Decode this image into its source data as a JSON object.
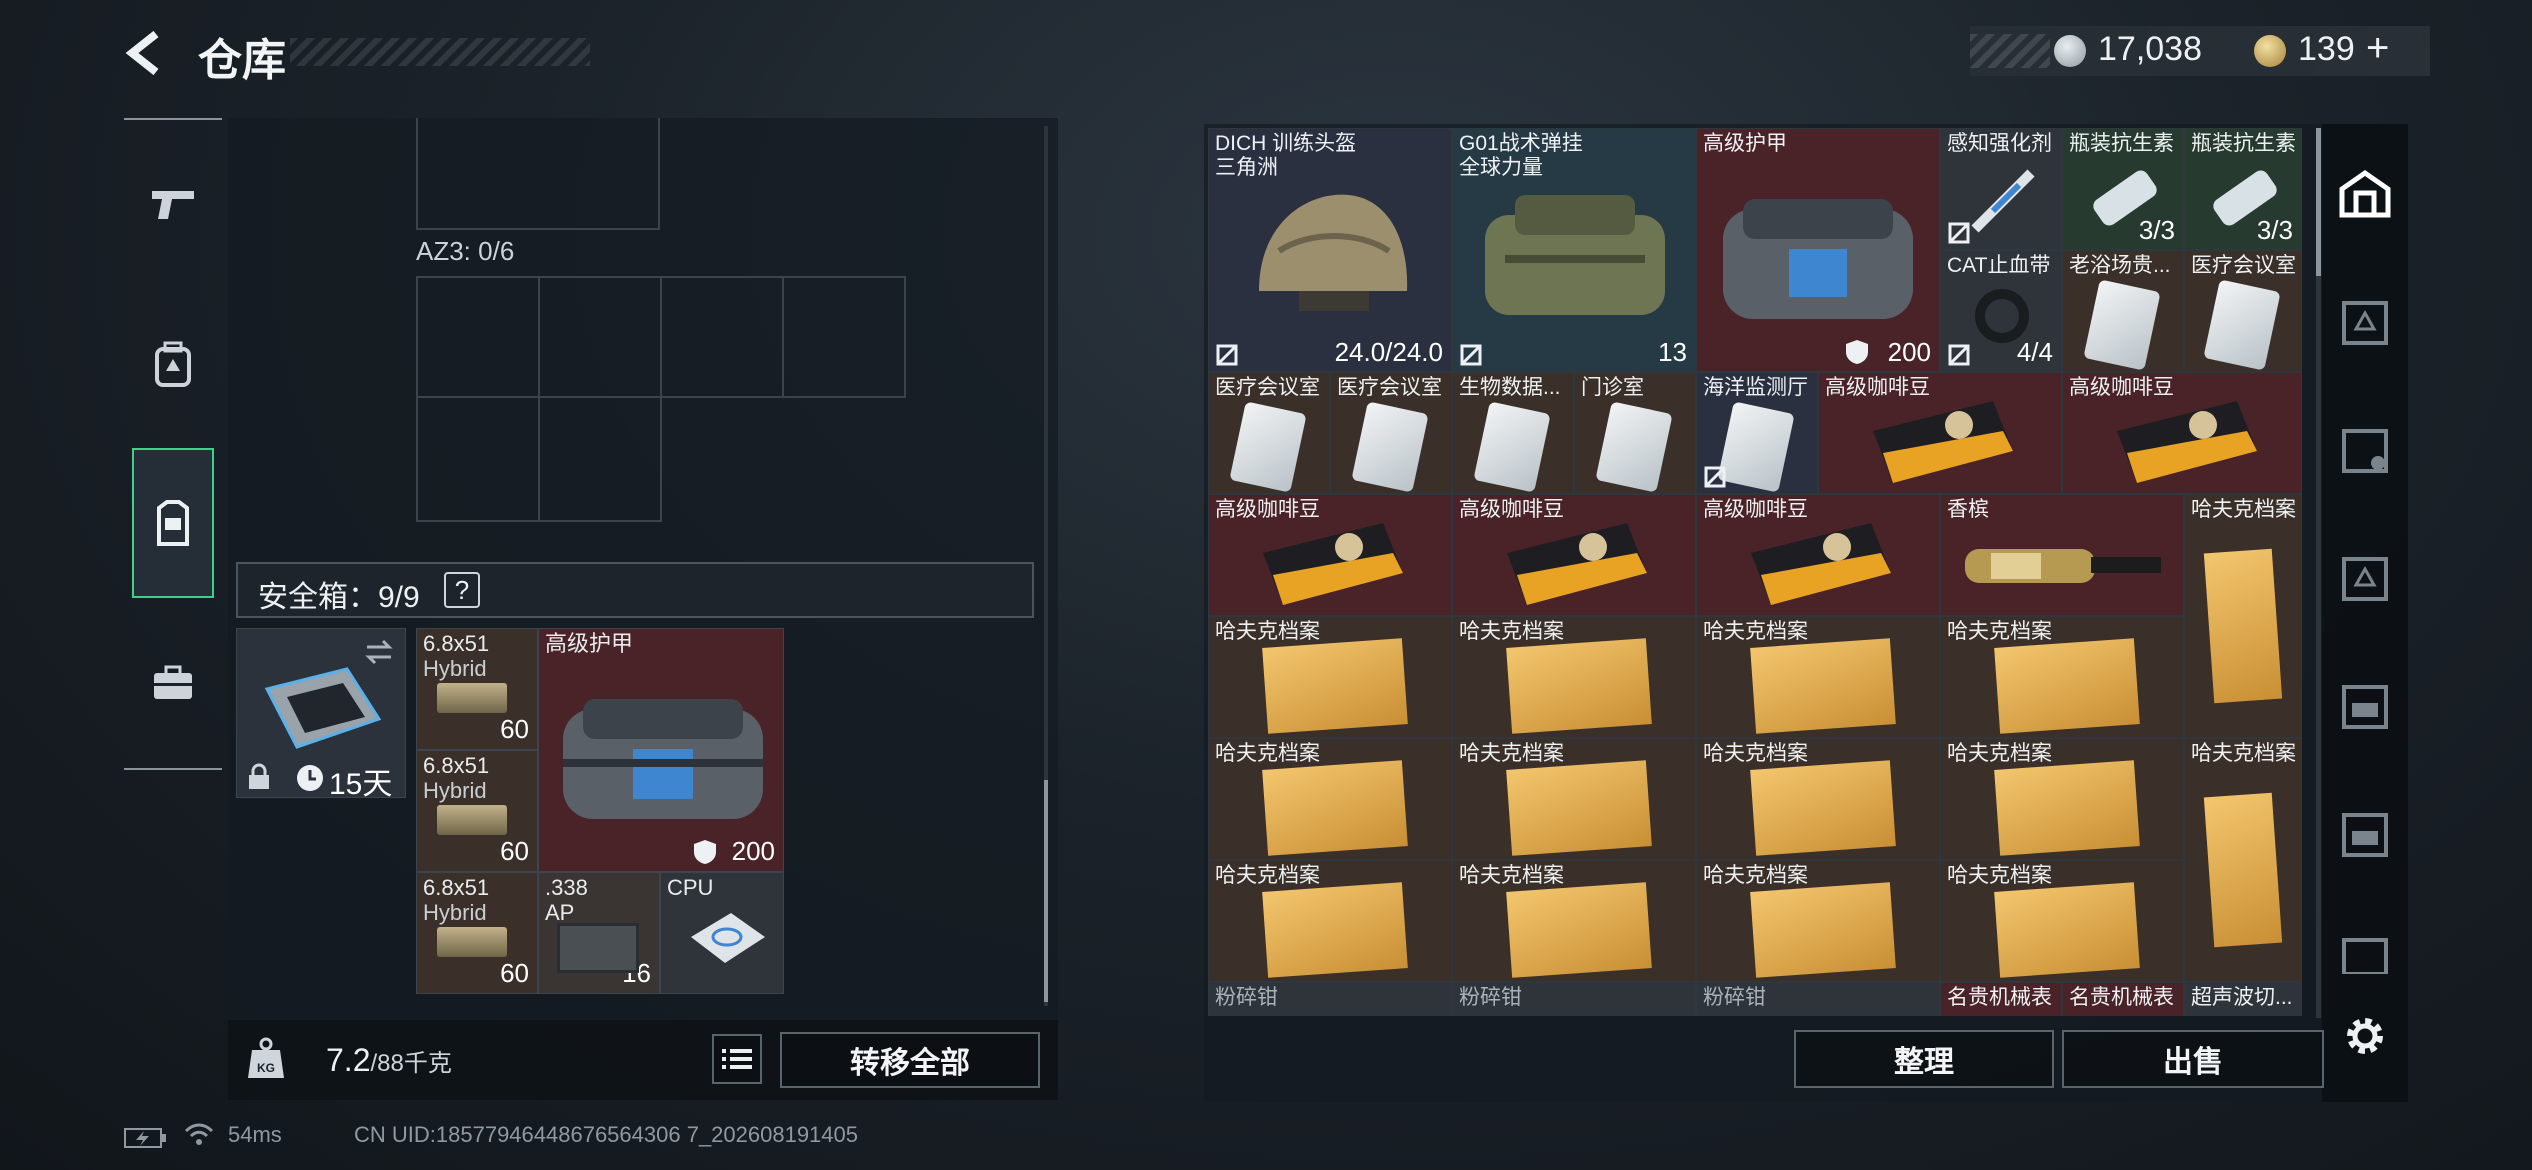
{
  "header": {
    "title": "仓库",
    "currency": [
      {
        "icon": "silver-coin-icon",
        "value": "17,038"
      },
      {
        "icon": "gold-coin-icon",
        "value": "139"
      }
    ],
    "add_symbol": "+"
  },
  "nav": {
    "items": [
      {
        "icon": "gun-icon",
        "active": false
      },
      {
        "icon": "backpack-icon",
        "active": false
      },
      {
        "icon": "vest-icon",
        "active": true
      },
      {
        "icon": "briefcase-icon",
        "active": false
      }
    ]
  },
  "left": {
    "az_label": "AZ3: 0/6",
    "safe_box_label": "安全箱：9/9",
    "help_symbol": "?",
    "case_days": "15天",
    "items": [
      {
        "name": "6.8x51",
        "sub": "Hybrid",
        "qty": "60"
      },
      {
        "name": "6.8x51",
        "sub": "Hybrid",
        "qty": "60"
      },
      {
        "name": "6.8x51",
        "sub": "Hybrid",
        "qty": "60"
      },
      {
        "name": "高级护甲",
        "qty": "200"
      },
      {
        "name": ".338",
        "sub": "AP",
        "qty": "16"
      },
      {
        "name": "CPU"
      }
    ],
    "weight_value": "7.2",
    "weight_cap": "/88千克",
    "transfer_all": "转移全部"
  },
  "right": {
    "cells": [
      {
        "name": "DICH 训练头盔",
        "sub": "三角洲",
        "qty": "24.0/24.0"
      },
      {
        "name": "G01战术弹挂",
        "sub": "全球力量",
        "qty": "13"
      },
      {
        "name": "高级护甲",
        "qty": "200"
      },
      {
        "name": "感知强化剂"
      },
      {
        "name": "瓶装抗生素",
        "qty": "3/3"
      },
      {
        "name": "瓶装抗生素",
        "qty": "3/3"
      },
      {
        "name": "CAT止血带",
        "qty": "4/4"
      },
      {
        "name": "老浴场贵..."
      },
      {
        "name": "医疗会议室"
      },
      {
        "name": "医疗会议室"
      },
      {
        "name": "医疗会议室"
      },
      {
        "name": "生物数据..."
      },
      {
        "name": "门诊室"
      },
      {
        "name": "海洋监测厅"
      },
      {
        "name": "高级咖啡豆"
      },
      {
        "name": "高级咖啡豆"
      },
      {
        "name": "高级咖啡豆"
      },
      {
        "name": "高级咖啡豆"
      },
      {
        "name": "高级咖啡豆"
      },
      {
        "name": "香槟"
      },
      {
        "name": "哈夫克档案"
      },
      {
        "name": "哈夫克档案"
      },
      {
        "name": "哈夫克档案"
      },
      {
        "name": "哈夫克档案"
      },
      {
        "name": "哈夫克档案"
      },
      {
        "name": "哈夫克档案"
      },
      {
        "name": "哈夫克档案"
      },
      {
        "name": "哈夫克档案"
      },
      {
        "name": "哈夫克档案"
      },
      {
        "name": "哈夫克档案"
      },
      {
        "name": "哈夫克档案"
      },
      {
        "name": "哈夫克档案"
      },
      {
        "name": "哈夫克档案"
      },
      {
        "name": "哈夫克档案"
      },
      {
        "name": "粉碎钳"
      },
      {
        "name": "粉碎钳"
      },
      {
        "name": "粉碎钳"
      },
      {
        "name": "名贵机械表"
      },
      {
        "name": "名贵机械表"
      },
      {
        "name": "超声波切..."
      }
    ],
    "sort_button": "整理",
    "sell_button": "出售"
  },
  "status": {
    "ping": "54ms",
    "uid": "CN UID:18577946448676564306 7_202608191405"
  },
  "colors": {
    "accent_green": "#3fd18a",
    "cell_red": "#4a2328",
    "cell_brown": "#3b3029"
  }
}
